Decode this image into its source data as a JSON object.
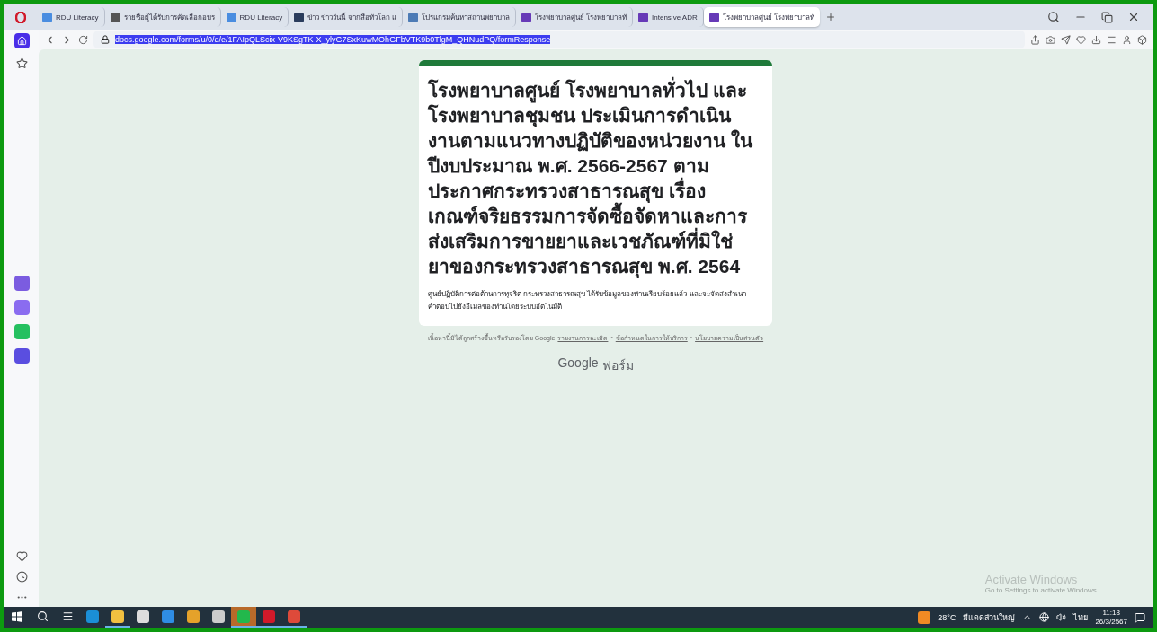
{
  "tabs": [
    {
      "title": "RDU Literacy",
      "selected": false
    },
    {
      "title": "รายชื่อผู้ได้รับการคัดเลือกอบร",
      "selected": false
    },
    {
      "title": "RDU Literacy",
      "selected": false
    },
    {
      "title": "ข่าว ข่าววันนี้ จากสื่อทั่วโลก แ",
      "selected": false
    },
    {
      "title": "โปรแกรมค้นหาสถานพยาบาล",
      "selected": false
    },
    {
      "title": "โรงพยาบาลศูนย์ โรงพยาบาลทั่",
      "selected": false
    },
    {
      "title": "Intensive ADR",
      "selected": false
    },
    {
      "title": "โรงพยาบาลศูนย์ โรงพยาบาลทั่",
      "selected": true
    }
  ],
  "address_bar": {
    "url": "docs.google.com/forms/u/0/d/e/1FAIpQLScix-V9KSgTK-X_ylyG7SxKuwMOhGFbVTK9b0TlgM_QHNudPQ/formResponse"
  },
  "form": {
    "title": "โรงพยาบาลศูนย์ โรงพยาบาลทั่วไป และโรงพยาบาลชุมชน ประเมินการดำเนินงานตามแนวทางปฏิบัติของหน่วยงาน ใน ปีงบประมาณ พ.ศ. 2566-2567 ตามประกาศกระทรวงสาธารณสุข เรื่อง เกณฑ์จริยธรรมการจัดซื้อจัดหาและการส่งเสริมการขายยาและเวชภัณฑ์ที่มิใช่ยาของกระทรวงสาธารณสุข พ.ศ. 2564",
    "message": "ศูนย์ปฏิบัติการต่อต้านการทุจริต กระทรวงสาธารณสุข ได้รับข้อมูลของท่านเรียบร้อยแล้ว และจะจัดส่งสำเนาคำตอบไปยังอีเมลของท่านโดยระบบอัตโนมัติ"
  },
  "footer": {
    "disclaimer": "เนื้อหานี้มิได้ถูกสร้างขึ้นหรือรับรองโดย Google",
    "links": [
      "รายงานการละเมิด",
      "ข้อกำหนดในการให้บริการ",
      "นโยบายความเป็นส่วนตัว"
    ],
    "separator": "-",
    "brand": "Google",
    "product": "ฟอร์ม"
  },
  "watermark": {
    "title": "Activate Windows",
    "subtitle": "Go to Settings to activate Windows."
  },
  "taskbar": {
    "apps": [
      {
        "kind": "edge",
        "selected": false
      },
      {
        "kind": "folder",
        "selected": true
      },
      {
        "kind": "store",
        "selected": false
      },
      {
        "kind": "mail",
        "selected": false
      },
      {
        "kind": "chrome",
        "selected": false
      },
      {
        "kind": "tool",
        "selected": false
      },
      {
        "kind": "line",
        "selected": true
      },
      {
        "kind": "opera",
        "selected": true
      },
      {
        "kind": "chrome2",
        "selected": true
      }
    ],
    "weather": "28°C",
    "weather_text": "มีแดดส่วนใหญ่",
    "language": "ไทย",
    "time": "11:18",
    "date": "26/3/2567"
  }
}
